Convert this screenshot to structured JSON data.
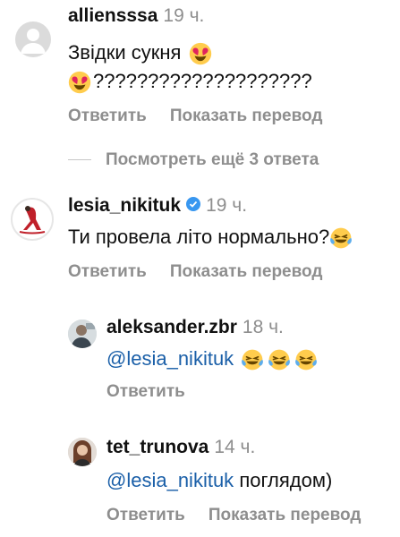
{
  "comments": [
    {
      "username": "alliensssa",
      "time": "19 ч.",
      "text_line1": "Звідки сукня",
      "text_line2": "????????????????????",
      "actions": {
        "reply": "Ответить",
        "translate": "Показать перевод"
      }
    },
    {
      "username": "lesia_nikituk",
      "time": "19 ч.",
      "text": "Ти провела літо нормально?",
      "actions": {
        "reply": "Ответить",
        "translate": "Показать перевод"
      }
    },
    {
      "username": "aleksander.zbr",
      "time": "18 ч.",
      "mention": "@lesia_nikituk",
      "actions": {
        "reply": "Ответить"
      }
    },
    {
      "username": "tet_trunova",
      "time": "14 ч.",
      "mention": "@lesia_nikituk",
      "text": "поглядом)",
      "actions": {
        "reply": "Ответить",
        "translate": "Показать перевод"
      }
    }
  ],
  "view_more_replies": "Посмотреть ещё 3 ответа",
  "icons": {
    "emoji_heart_eyes": "heart-eyes-emoji",
    "emoji_laughing": "tears-of-joy-emoji",
    "verified": "verified-badge-icon"
  },
  "colors": {
    "mention": "#1a5fa8",
    "muted": "#8e8e8e",
    "verified": "#3897f0"
  }
}
